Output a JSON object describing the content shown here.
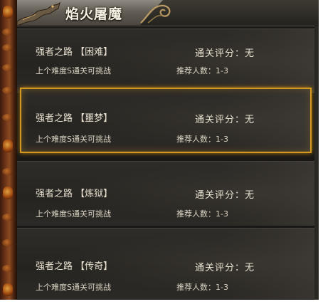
{
  "window": {
    "title": "焰火屠魔"
  },
  "stages": [
    {
      "name": "强者之路 【困难】",
      "score": "通关评分：无",
      "unlock": "上个难度S通关可挑战",
      "players": "推荐人数：1-3",
      "selected": false
    },
    {
      "name": "强者之路 【噩梦】",
      "score": "通关评分：无",
      "unlock": "上个难度S通关可挑战",
      "players": "推荐人数：1-3",
      "selected": true
    },
    {
      "name": "强者之路 【炼狱】",
      "score": "通关评分：无",
      "unlock": "上个难度S通关可挑战",
      "players": "推荐人数：1-3",
      "selected": false
    },
    {
      "name": "强者之路 【传奇】",
      "score": "通关评分：无",
      "unlock": "上个难度S通关可挑战",
      "players": "推荐人数：1-3",
      "selected": false
    }
  ],
  "colors": {
    "selected_border": "#d3981e",
    "text": "#e9e2d2",
    "panel": "#2b2925"
  },
  "icons": {
    "title_dragon": "dragon-ornament-icon",
    "title_swirl": "swirl-ornament-icon"
  }
}
